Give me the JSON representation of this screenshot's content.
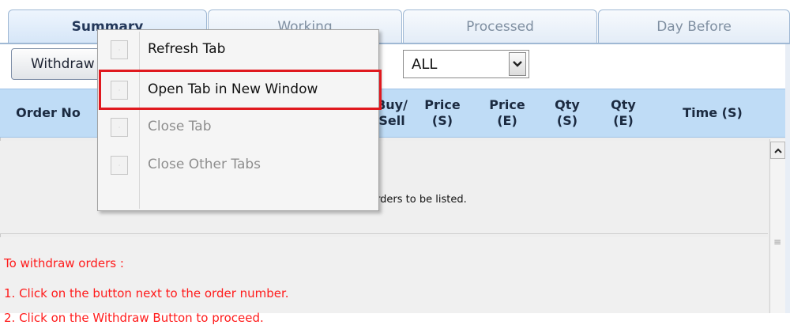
{
  "tabs": [
    {
      "label": "Summary",
      "active": true
    },
    {
      "label": "Working",
      "active": false
    },
    {
      "label": "Processed",
      "active": false
    },
    {
      "label": "Day Before",
      "active": false
    }
  ],
  "toolbar": {
    "withdraw_label": "Withdraw",
    "filter_value": "ALL"
  },
  "columns": {
    "order_no": "Order No",
    "buy_sell_l1": "Buy/",
    "buy_sell_l2": "Sell",
    "price_s_l1": "Price",
    "price_s_l2": "(S)",
    "price_e_l1": "Price",
    "price_e_l2": "(E)",
    "qty_s_l1": "Qty",
    "qty_s_l2": "(S)",
    "qty_e_l1": "Qty",
    "qty_e_l2": "(E)",
    "time_s": "Time (S)"
  },
  "list": {
    "empty_message": "There are no orders to be listed."
  },
  "instructions": {
    "heading": "To withdraw orders :",
    "step1": "1. Click on the button next to the order number.",
    "step2": "2. Click on the Withdraw Button to proceed."
  },
  "context_menu": {
    "items": [
      {
        "label": "Refresh Tab",
        "enabled": true
      },
      {
        "label": "Open Tab in New Window",
        "enabled": true,
        "highlighted": true
      },
      {
        "label": "Close Tab",
        "enabled": false
      },
      {
        "label": "Close Other Tabs",
        "enabled": false
      }
    ]
  },
  "colors": {
    "tab_border": "#9fb8d4",
    "header_bg": "#bfdcf6",
    "instruction_text": "#ff1b1b",
    "highlight_box": "#e0191f"
  }
}
